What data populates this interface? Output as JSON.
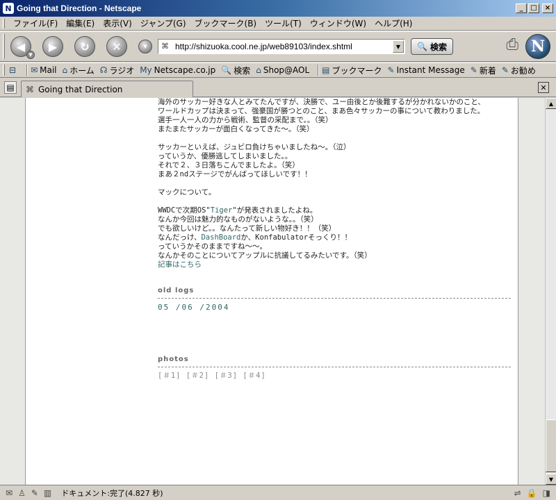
{
  "window": {
    "title": "Going that Direction - Netscape",
    "app_icon": "N",
    "minimize_glyph": "_",
    "maximize_glyph": "□",
    "close_glyph": "×"
  },
  "menubar": {
    "items": [
      "ファイル(F)",
      "編集(E)",
      "表示(V)",
      "ジャンプ(G)",
      "ブックマーク(B)",
      "ツール(T)",
      "ウィンドウ(W)",
      "ヘルプ(H)"
    ]
  },
  "navbar": {
    "back_icon": "back-arrow-icon",
    "forward_icon": "forward-arrow-icon",
    "reload_icon": "reload-icon",
    "stop_icon": "stop-icon",
    "url": "http://shizuoka.cool.ne.jp/web89103/index.shtml",
    "search_label": "検索"
  },
  "personalbar": {
    "items": [
      {
        "icon": "✉",
        "label": "Mail"
      },
      {
        "icon": "⌂",
        "label": "ホーム"
      },
      {
        "icon": "☊",
        "label": "ラジオ"
      },
      {
        "icon": "My",
        "label": "Netscape.co.jp"
      },
      {
        "icon": "🔍",
        "label": "検索"
      },
      {
        "icon": "⌂",
        "label": "Shop@AOL"
      },
      {
        "icon": "▤",
        "label": "ブックマーク"
      },
      {
        "icon": "✎",
        "label": "Instant Message"
      },
      {
        "icon": "✎",
        "label": "新着"
      },
      {
        "icon": "✎",
        "label": "お勧め"
      }
    ]
  },
  "tab": {
    "label": "Going that Direction"
  },
  "content": {
    "lines": [
      "海外のサッカー好きな人とみてたんですが、決勝で、ユー由後とか後難するが分かれないかのこと、",
      "ワールドカップは決まって、強豪国が勝つとのこと、まあ色々サッカーの事について教わりました。",
      "選手一人一人の力から戦術、監督の采配まで。。（笑）",
      "またまたサッカーが面白くなってきた〜。（笑）",
      "",
      "サッカーといえば、ジュビロ負けちゃいましたね〜。（泣）",
      "っていうか、優勝逃してしまいました。。",
      "それで２、３日落ちこんでましたよ。（笑）",
      "まあ２ndステージでがんばってほしいです！！",
      "",
      "マックについて。",
      ""
    ],
    "mac_line1_pre": "WWDCで次期OS\"",
    "mac_line1_link": "Tiger",
    "mac_line1_post": "\"が発表されましたよね。",
    "mac_lines": [
      "なんか今回は魅力的なものがないような。。（笑）",
      "でも欲しいけど。。なんたって新しい物好き！！（笑）"
    ],
    "dash_pre": "なんだっけ、",
    "dash_link": "DashBoard",
    "dash_post": "か、Konfabulatorそっくり！！",
    "tail_lines": [
      "っていうかそのままですね〜〜。",
      "なんかそのことについてアップルに抗議してるみたいです。（笑）"
    ],
    "article_link": "記事はこちら",
    "old_logs_heading": "old logs",
    "old_logs_link": "05 /06 /2004",
    "photos_heading": "photos",
    "photo_links": "[＃1] [＃2] [＃3] [＃4]"
  },
  "statusbar": {
    "text": "ドキュメント:完了(4.827 秒)"
  }
}
